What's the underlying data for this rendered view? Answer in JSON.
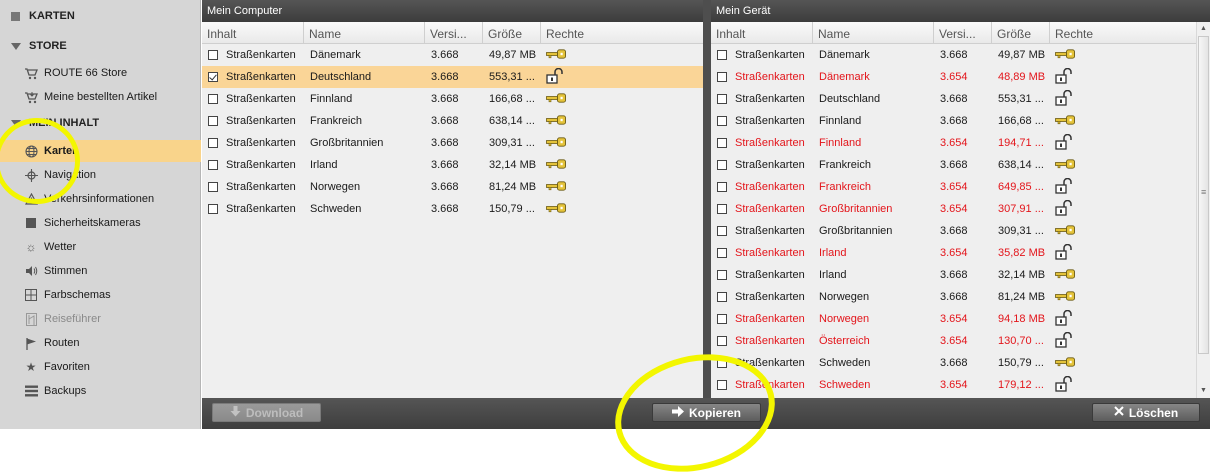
{
  "sidebar": {
    "sections": [
      {
        "label": "KARTEN",
        "icon": "square-icon"
      },
      {
        "label": "STORE",
        "icon": "triangle-down-icon"
      },
      {
        "label": "MEIN INHALT",
        "icon": "triangle-down-icon"
      }
    ],
    "store_items": [
      {
        "label": "ROUTE 66 Store",
        "icon": "cart-icon"
      },
      {
        "label": "Meine bestellten Artikel",
        "icon": "cart-arrow-icon"
      }
    ],
    "content_items": [
      {
        "label": "Karten",
        "icon": "globe-icon",
        "active": true
      },
      {
        "label": "Navigation",
        "icon": "crosshair-icon"
      },
      {
        "label": "Verkehrsinformationen",
        "icon": "warning-icon"
      },
      {
        "label": "Sicherheitskameras",
        "icon": "camera-icon"
      },
      {
        "label": "Wetter",
        "icon": "sun-icon"
      },
      {
        "label": "Stimmen",
        "icon": "speaker-icon"
      },
      {
        "label": "Farbschemas",
        "icon": "grid-icon"
      },
      {
        "label": "Reiseführer",
        "icon": "book-icon",
        "disabled": true
      },
      {
        "label": "Routen",
        "icon": "flag-icon"
      },
      {
        "label": "Favoriten",
        "icon": "star-icon"
      },
      {
        "label": "Backups",
        "icon": "backups-icon"
      }
    ]
  },
  "columns": [
    "Inhalt",
    "Name",
    "Versi...",
    "Größe",
    "Rechte"
  ],
  "left_panel": {
    "title": "Mein Computer",
    "rows": [
      {
        "inhalt": "Straßenkarten",
        "name": "Dänemark",
        "version": "3.668",
        "size": "49,87 MB",
        "rights": "key-icon",
        "checked": false
      },
      {
        "inhalt": "Straßenkarten",
        "name": "Deutschland",
        "version": "3.668",
        "size": "553,31 ...",
        "rights": "lock-icon",
        "checked": true,
        "selected": true
      },
      {
        "inhalt": "Straßenkarten",
        "name": "Finnland",
        "version": "3.668",
        "size": "166,68 ...",
        "rights": "key-icon",
        "checked": false
      },
      {
        "inhalt": "Straßenkarten",
        "name": "Frankreich",
        "version": "3.668",
        "size": "638,14 ...",
        "rights": "key-icon",
        "checked": false
      },
      {
        "inhalt": "Straßenkarten",
        "name": "Großbritannien",
        "version": "3.668",
        "size": "309,31 ...",
        "rights": "key-icon",
        "checked": false
      },
      {
        "inhalt": "Straßenkarten",
        "name": "Irland",
        "version": "3.668",
        "size": "32,14 MB",
        "rights": "key-icon",
        "checked": false
      },
      {
        "inhalt": "Straßenkarten",
        "name": "Norwegen",
        "version": "3.668",
        "size": "81,24 MB",
        "rights": "key-icon",
        "checked": false
      },
      {
        "inhalt": "Straßenkarten",
        "name": "Schweden",
        "version": "3.668",
        "size": "150,79 ...",
        "rights": "key-icon",
        "checked": false
      }
    ]
  },
  "right_panel": {
    "title": "Mein Gerät",
    "rows": [
      {
        "inhalt": "Straßenkarten",
        "name": "Dänemark",
        "version": "3.668",
        "size": "49,87 MB",
        "rights": "key-icon",
        "red": false
      },
      {
        "inhalt": "Straßenkarten",
        "name": "Dänemark",
        "version": "3.654",
        "size": "48,89 MB",
        "rights": "lock-icon",
        "red": true
      },
      {
        "inhalt": "Straßenkarten",
        "name": "Deutschland",
        "version": "3.668",
        "size": "553,31 ...",
        "rights": "lock-icon",
        "red": false
      },
      {
        "inhalt": "Straßenkarten",
        "name": "Finnland",
        "version": "3.668",
        "size": "166,68 ...",
        "rights": "key-icon",
        "red": false
      },
      {
        "inhalt": "Straßenkarten",
        "name": "Finnland",
        "version": "3.654",
        "size": "194,71 ...",
        "rights": "lock-icon",
        "red": true
      },
      {
        "inhalt": "Straßenkarten",
        "name": "Frankreich",
        "version": "3.668",
        "size": "638,14 ...",
        "rights": "key-icon",
        "red": false
      },
      {
        "inhalt": "Straßenkarten",
        "name": "Frankreich",
        "version": "3.654",
        "size": "649,85 ...",
        "rights": "lock-icon",
        "red": true
      },
      {
        "inhalt": "Straßenkarten",
        "name": "Großbritannien",
        "version": "3.654",
        "size": "307,91 ...",
        "rights": "lock-icon",
        "red": true
      },
      {
        "inhalt": "Straßenkarten",
        "name": "Großbritannien",
        "version": "3.668",
        "size": "309,31 ...",
        "rights": "key-icon",
        "red": false
      },
      {
        "inhalt": "Straßenkarten",
        "name": "Irland",
        "version": "3.654",
        "size": "35,82 MB",
        "rights": "lock-icon",
        "red": true
      },
      {
        "inhalt": "Straßenkarten",
        "name": "Irland",
        "version": "3.668",
        "size": "32,14 MB",
        "rights": "key-icon",
        "red": false
      },
      {
        "inhalt": "Straßenkarten",
        "name": "Norwegen",
        "version": "3.668",
        "size": "81,24 MB",
        "rights": "key-icon",
        "red": false
      },
      {
        "inhalt": "Straßenkarten",
        "name": "Norwegen",
        "version": "3.654",
        "size": "94,18 MB",
        "rights": "lock-icon",
        "red": true
      },
      {
        "inhalt": "Straßenkarten",
        "name": "Österreich",
        "version": "3.654",
        "size": "130,70 ...",
        "rights": "lock-icon",
        "red": true
      },
      {
        "inhalt": "Straßenkarten",
        "name": "Schweden",
        "version": "3.668",
        "size": "150,79 ...",
        "rights": "key-icon",
        "red": false
      },
      {
        "inhalt": "Straßenkarten",
        "name": "Schweden",
        "version": "3.654",
        "size": "179,12 ...",
        "rights": "lock-icon",
        "red": true
      }
    ]
  },
  "buttons": {
    "download": "Download",
    "copy": "Kopieren",
    "delete": "Löschen"
  },
  "colors": {
    "selected_row": "#fad597",
    "outdated_text": "#e3151b",
    "highlight_marker": "#f3f600"
  }
}
